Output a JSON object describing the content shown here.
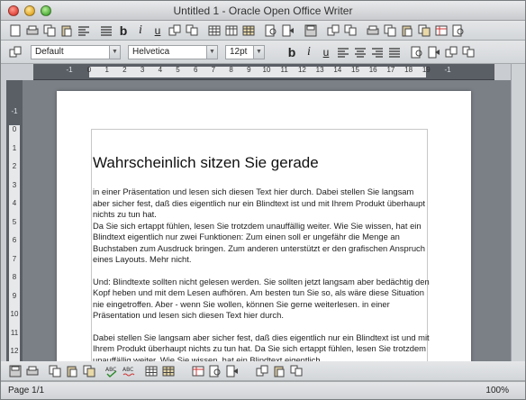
{
  "window": {
    "title": "Untitled 1 - Oracle Open Office Writer"
  },
  "format_toolbar": {
    "style_value": "Default",
    "font_value": "Helvetica",
    "size_value": "12pt",
    "bold_label": "b",
    "italic_label": "i",
    "underline_label": "u"
  },
  "standard_toolbar": {
    "bold_label": "b",
    "italic_label": "i",
    "underline_label": "u"
  },
  "hruler": {
    "labels": [
      "-1",
      "0",
      "1",
      "2",
      "3",
      "4",
      "5",
      "6",
      "7",
      "8",
      "9",
      "10",
      "11",
      "12",
      "13",
      "14",
      "15",
      "16",
      "17",
      "18",
      "19",
      "-1"
    ]
  },
  "vruler": {
    "labels": [
      "-1",
      "0",
      "1",
      "2",
      "3",
      "4",
      "5",
      "6",
      "7",
      "8",
      "9",
      "10",
      "11",
      "12"
    ]
  },
  "document": {
    "heading": "Wahrscheinlich sitzen Sie gerade",
    "paragraphs": [
      "in einer Präsentation und lesen sich diesen Text hier durch. Dabei stellen Sie langsam aber sicher fest, daß dies eigentlich nur ein Blindtext ist und mit Ihrem Produkt überhaupt nichts zu tun hat.",
      "Da Sie sich ertappt fühlen, lesen Sie trotzdem unauffällig weiter. Wie Sie wissen, hat ein Blindtext eigentlich nur zwei Funktionen: Zum einen soll er ungefähr die Menge an Buchstaben zum Ausdruck bringen. Zum anderen unterstützt er den grafischen Anspruch eines Layouts. Mehr nicht.",
      "Und: Blindtexte sollten nicht gelesen werden. Sie sollten jetzt langsam aber bedächtig den Kopf heben und mit dem Lesen aufhören. Am besten tun Sie so, als wäre diese Situation nie eingetroffen. Aber - wenn Sie wollen, können Sie gerne weiterlesen. in einer Präsentation und lesen sich diesen Text hier durch.",
      "Dabei stellen Sie langsam aber sicher fest, daß dies eigentlich nur ein Blindtext ist und mit Ihrem Produkt überhaupt nichts zu tun hat. Da Sie sich ertappt fühlen, lesen Sie trotzdem unauffällig weiter. Wie Sie wissen, hat ein Blindtext eigentlich"
    ]
  },
  "status": {
    "page": "Page 1/1",
    "zoom": "100%"
  },
  "colors": {
    "ruler": "#5a5f66",
    "doc_background": "#7b8087",
    "chrome": "#d3d6d9"
  }
}
